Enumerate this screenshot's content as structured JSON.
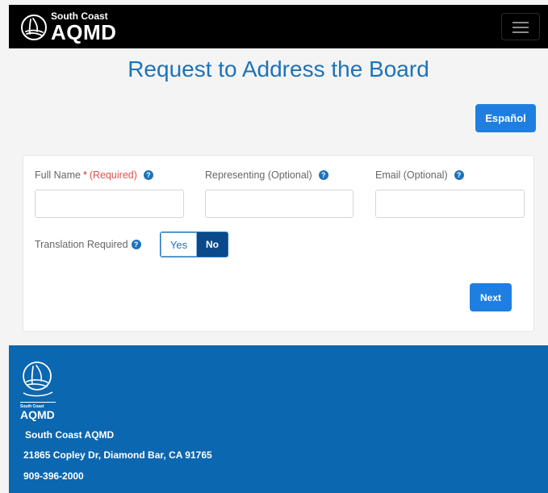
{
  "header": {
    "brand_small": "South Coast",
    "brand_big": "AQMD"
  },
  "page": {
    "title": "Request to Address the Board",
    "language_button": "Español"
  },
  "form": {
    "full_name": {
      "label": "Full Name",
      "required_star": "*",
      "required_text": "(Required)",
      "value": ""
    },
    "representing": {
      "label": "Representing (Optional)",
      "value": ""
    },
    "email": {
      "label": "Email (Optional)",
      "value": ""
    },
    "translation": {
      "label": "Translation Required",
      "yes": "Yes",
      "no": "No",
      "selected": "No"
    },
    "next_button": "Next",
    "help_glyph": "?"
  },
  "footer": {
    "logo_small": "South Coast",
    "logo_big": "AQMD",
    "org_name": "South Coast AQMD",
    "address": "21865 Copley Dr, Diamond Bar, CA 91765",
    "phone": "909-396-2000"
  },
  "colors": {
    "nav_bg": "#000000",
    "title_blue": "#1d73b8",
    "button_blue": "#1e7fe0",
    "toggle_active": "#0a4a8a",
    "footer_bg": "#0b67b0",
    "required_red": "#d9534f"
  }
}
